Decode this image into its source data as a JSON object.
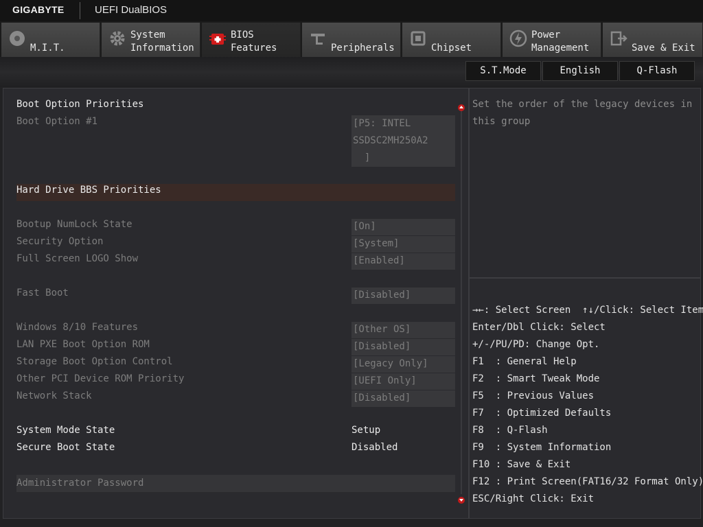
{
  "header": {
    "brand": "GIGABYTE",
    "subtitle": "UEFI DualBIOS"
  },
  "tabs": [
    {
      "line1": "",
      "line2": "M.I.T.",
      "icon": "disc-icon"
    },
    {
      "line1": "System",
      "line2": "Information",
      "icon": "gear-icon"
    },
    {
      "line1": "BIOS",
      "line2": "Features",
      "icon": "bios-chip-icon"
    },
    {
      "line1": "",
      "line2": "Peripherals",
      "icon": "connector-icon"
    },
    {
      "line1": "",
      "line2": "Chipset",
      "icon": "chip-icon"
    },
    {
      "line1": "Power",
      "line2": "Management",
      "icon": "power-icon"
    },
    {
      "line1": "",
      "line2": "Save & Exit",
      "icon": "exit-icon"
    }
  ],
  "toolbar": {
    "st_mode": "S.T.Mode",
    "language": "English",
    "qflash": "Q-Flash"
  },
  "settings": {
    "boot_priorities": "Boot Option Priorities",
    "boot_option1_label": "Boot Option #1",
    "boot_option1_value": "[P5: INTEL\nSSDSC2MH250A2\n  ]",
    "hdd_bbs": "Hard Drive BBS Priorities",
    "numlock_label": "Bootup NumLock State",
    "numlock_value": "[On]",
    "security_label": "Security Option",
    "security_value": "[System]",
    "logo_label": "Full Screen LOGO Show",
    "logo_value": "[Enabled]",
    "fastboot_label": "Fast Boot",
    "fastboot_value": "[Disabled]",
    "win_label": "Windows 8/10 Features",
    "win_value": "[Other OS]",
    "lanpxe_label": "LAN PXE Boot Option ROM",
    "lanpxe_value": "[Disabled]",
    "storage_label": "Storage Boot Option Control",
    "storage_value": "[Legacy Only]",
    "otherpci_label": "Other PCI Device ROM Priority",
    "otherpci_value": "[UEFI Only]",
    "netstack_label": "Network Stack",
    "netstack_value": "[Disabled]",
    "sysmode_label": "System Mode State",
    "sysmode_value": "Setup",
    "secureboot_label": "Secure Boot State",
    "secureboot_value": "Disabled",
    "admin_password": "Administrator Password"
  },
  "help": {
    "text": "Set the order of the legacy devices in this group"
  },
  "keys": [
    "→←: Select Screen  ↑↓/Click: Select Item",
    "Enter/Dbl Click: Select",
    "+/-/PU/PD: Change Opt.",
    "F1  : General Help",
    "F2  : Smart Tweak Mode",
    "F5  : Previous Values",
    "F7  : Optimized Defaults",
    "F8  : Q-Flash",
    "F9  : System Information",
    "F10 : Save & Exit",
    "F12 : Print Screen(FAT16/32 Format Only)",
    "ESC/Right Click: Exit"
  ],
  "colors": {
    "accent": "#c21a1a",
    "highlight": "#3a2a26"
  }
}
